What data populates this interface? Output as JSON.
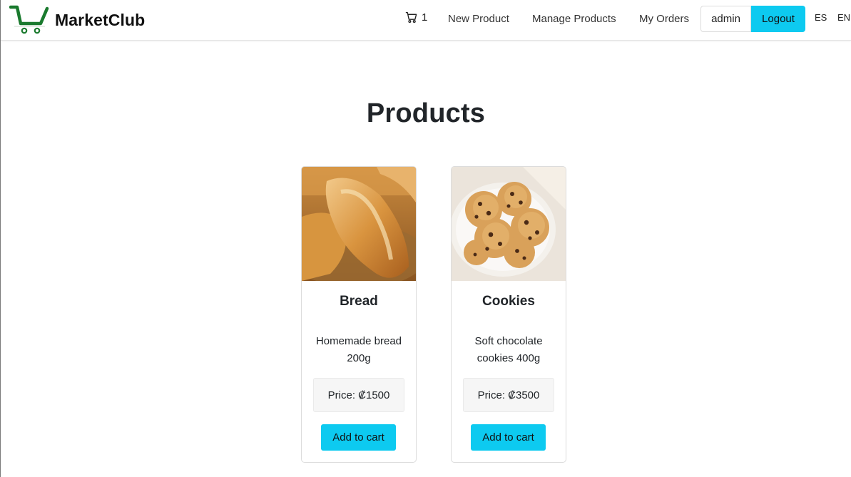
{
  "brand": {
    "name": "MarketClub",
    "icon": "shopping-cart-logo",
    "color": "#1a7a2e"
  },
  "nav": {
    "cart_icon": "cart-icon",
    "cart_count": "1",
    "new_product": "New Product",
    "manage_products": "Manage Products",
    "my_orders": "My Orders",
    "username": "admin",
    "logout": "Logout",
    "lang_es": "ES",
    "lang_en": "EN"
  },
  "page": {
    "title": "Products"
  },
  "products": [
    {
      "name": "Bread",
      "description": "Homemade bread 200g",
      "price": "Price: ₡1500",
      "button": "Add to cart",
      "image": "bread-photo"
    },
    {
      "name": "Cookies",
      "description": "Soft chocolate cookies 400g",
      "price": "Price: ₡3500",
      "button": "Add to cart",
      "image": "cookies-photo"
    }
  ],
  "colors": {
    "accent": "#0dcaf0",
    "text": "#212529",
    "price_bg": "#f6f6f6"
  }
}
